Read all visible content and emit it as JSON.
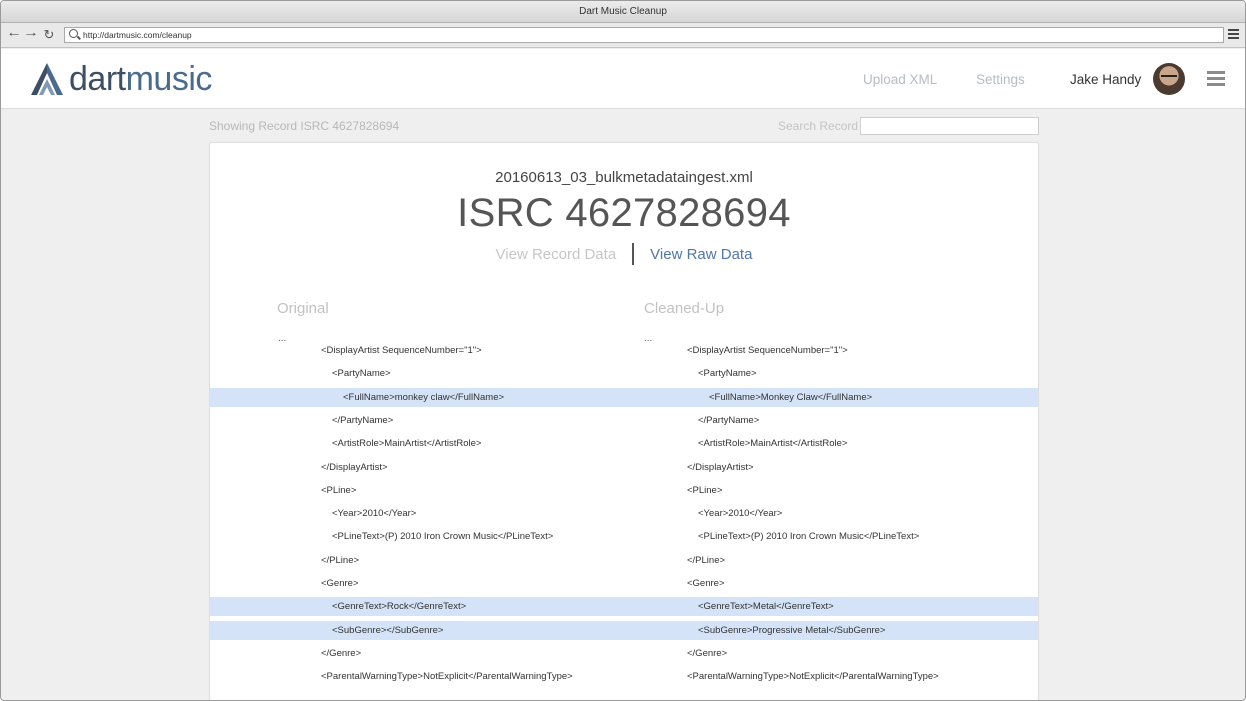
{
  "window": {
    "title": "Dart Music Cleanup"
  },
  "browser": {
    "url": "http://dartmusic.com/cleanup"
  },
  "header": {
    "logo_part1": "dart",
    "logo_part2": "music",
    "nav": {
      "upload": "Upload XML",
      "settings": "Settings"
    },
    "user_name": "Jake Handy"
  },
  "subbar": {
    "showing": "Showing Record ISRC 4627828694",
    "search_label": "Search Record",
    "search_value": ""
  },
  "record": {
    "filename": "20160613_03_bulkmetadataingest.xml",
    "isrc": "ISRC 4627828694",
    "view_record": "View Record Data",
    "view_raw": "View Raw Data"
  },
  "comparison": {
    "original_title": "Original",
    "cleaned_title": "Cleaned-Up",
    "ellipsis": "...",
    "lines": [
      {
        "indent": 1,
        "highlight": false,
        "original": "<DisplayArtist SequenceNumber=\"1\">",
        "cleaned": "<DisplayArtist SequenceNumber=\"1\">"
      },
      {
        "indent": 2,
        "highlight": false,
        "original": "<PartyName>",
        "cleaned": "<PartyName>"
      },
      {
        "indent": 3,
        "highlight": true,
        "original": "<FullName>monkey claw</FullName>",
        "cleaned": "<FullName>Monkey Claw</FullName>"
      },
      {
        "indent": 2,
        "highlight": false,
        "original": "</PartyName>",
        "cleaned": "</PartyName>"
      },
      {
        "indent": 2,
        "highlight": false,
        "original": "<ArtistRole>MainArtist</ArtistRole>",
        "cleaned": "<ArtistRole>MainArtist</ArtistRole>"
      },
      {
        "indent": 1,
        "highlight": false,
        "original": "</DisplayArtist>",
        "cleaned": "</DisplayArtist>"
      },
      {
        "indent": 1,
        "highlight": false,
        "original": "<PLine>",
        "cleaned": "<PLine>"
      },
      {
        "indent": 2,
        "highlight": false,
        "original": "<Year>2010</Year>",
        "cleaned": "<Year>2010</Year>"
      },
      {
        "indent": 2,
        "highlight": false,
        "original": "<PLineText>(P) 2010 Iron Crown Music</PLineText>",
        "cleaned": "<PLineText>(P) 2010 Iron Crown Music</PLineText>"
      },
      {
        "indent": 1,
        "highlight": false,
        "original": "</PLine>",
        "cleaned": "</PLine>"
      },
      {
        "indent": 1,
        "highlight": false,
        "original": "<Genre>",
        "cleaned": "<Genre>"
      },
      {
        "indent": 2,
        "highlight": true,
        "original": "<GenreText>Rock</GenreText>",
        "cleaned": "<GenreText>Metal</GenreText>"
      },
      {
        "indent": 2,
        "highlight": true,
        "original": "<SubGenre></SubGenre>",
        "cleaned": "<SubGenre>Progressive Metal</SubGenre>"
      },
      {
        "indent": 1,
        "highlight": false,
        "original": "</Genre>",
        "cleaned": "</Genre>"
      },
      {
        "indent": 1,
        "highlight": false,
        "original": "<ParentalWarningType>NotExplicit</ParentalWarningType>",
        "cleaned": "<ParentalWarningType>NotExplicit</ParentalWarningType>"
      }
    ]
  },
  "colors": {
    "accent": "#4f77a8",
    "highlight": "#d4e3f7",
    "logo_dark": "#3d4f63"
  }
}
